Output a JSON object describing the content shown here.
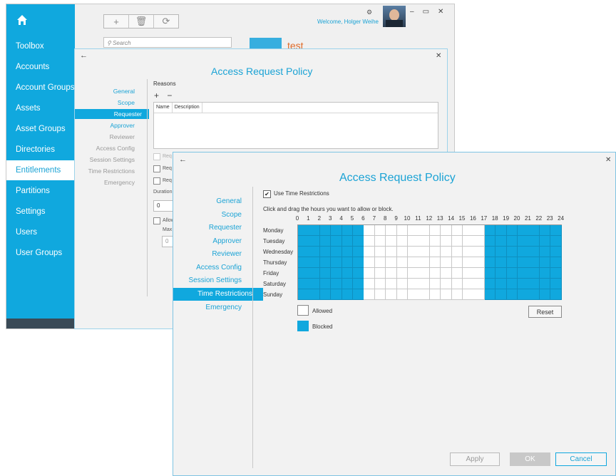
{
  "main": {
    "nav": [
      "Toolbox",
      "Accounts",
      "Account Groups",
      "Assets",
      "Asset Groups",
      "Directories",
      "Entitlements",
      "Partitions",
      "Settings",
      "Users",
      "User Groups"
    ],
    "active_nav": "Entitlements",
    "toolbar": {
      "add": "+",
      "delete": "🗑",
      "refresh": "⟳"
    },
    "search_placeholder": "Search",
    "welcome": "Welcome, Holger Weihe",
    "window_controls": {
      "minimize": "–",
      "maximize": "▭",
      "close": "✕"
    },
    "settings_glyph": "⚙",
    "entity_title": "test"
  },
  "dialog1": {
    "back": "←",
    "close": "✕",
    "title": "Access Request Policy",
    "sidebar": [
      "General",
      "Scope",
      "Requester",
      "Approver",
      "Reviewer",
      "Access Config",
      "Session Settings",
      "Time Restrictions",
      "Emergency"
    ],
    "sidebar_active": "Requester",
    "reasons_label": "Reasons",
    "add_remove": "+ −",
    "columns": [
      "Name",
      "Description"
    ],
    "partial": {
      "req1": "Req",
      "req2": "Req",
      "req3": "Req",
      "duration": "Duration",
      "duration_value": "0",
      "allow": "Allow",
      "max": "Max",
      "max_value": "0"
    }
  },
  "dialog2": {
    "back": "←",
    "close": "✕",
    "title": "Access Request Policy",
    "sidebar": [
      "General",
      "Scope",
      "Requester",
      "Approver",
      "Reviewer",
      "Access Config",
      "Session Settings",
      "Time Restrictions",
      "Emergency"
    ],
    "sidebar_active": "Time Restrictions",
    "use_time_restrictions_label": "Use Time Restrictions",
    "use_time_restrictions_checked": true,
    "checkmark": "✔",
    "instructions": "Click and drag the hours you want to allow or block.",
    "hours": [
      "0",
      "1",
      "2",
      "3",
      "4",
      "5",
      "6",
      "7",
      "8",
      "9",
      "10",
      "11",
      "12",
      "13",
      "14",
      "15",
      "16",
      "17",
      "18",
      "19",
      "20",
      "21",
      "22",
      "23",
      "24"
    ],
    "days": [
      "Monday",
      "Tuesday",
      "Wednesday",
      "Thursday",
      "Friday",
      "Saturday",
      "Sunday"
    ],
    "blocked_hours": [
      0,
      1,
      2,
      3,
      4,
      5,
      17,
      18,
      19,
      20,
      21,
      22,
      23
    ],
    "legend": {
      "allowed": "Allowed",
      "blocked": "Blocked"
    },
    "reset_label": "Reset",
    "buttons": {
      "apply": "Apply",
      "ok": "OK",
      "cancel": "Cancel"
    },
    "colors": {
      "blocked": "#10a8de",
      "allowed": "#ffffff",
      "accent": "#1ba3d5"
    }
  }
}
